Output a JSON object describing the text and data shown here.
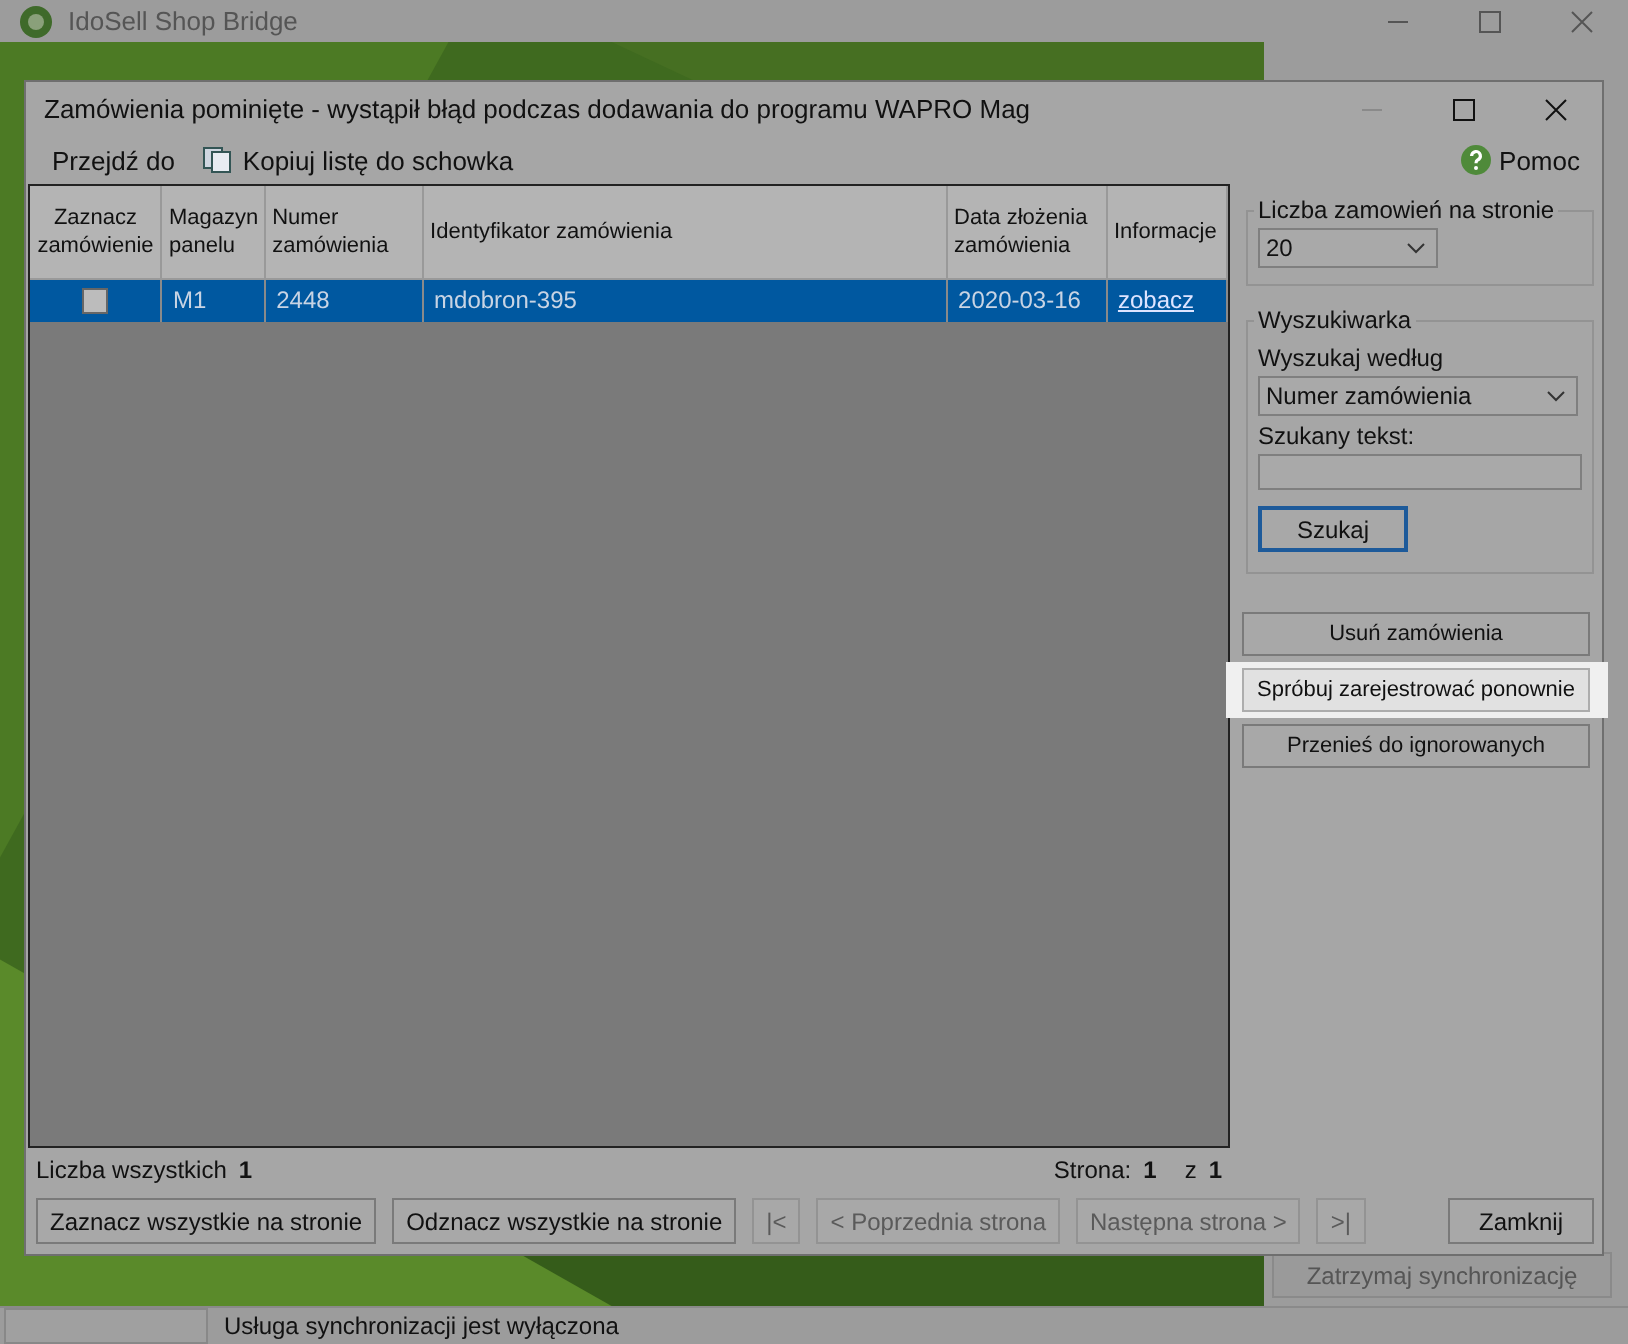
{
  "main_window": {
    "title": "IdoSell Shop Bridge",
    "stop_button": {
      "label": "Zatrzymaj synchronizację",
      "disabled": true
    },
    "sync_progress": {
      "level": 0
    },
    "status_bar": "Usługa synchronizacji jest wyłączona"
  },
  "dialog": {
    "title": "Zamówienia pominięte - wystąpił błąd podczas dodawania do programu WAPRO Mag",
    "toolbar": [
      {
        "label": "Przejdź do",
        "kind": "menu"
      },
      {
        "label": "Kopiuj listę do schowka",
        "kind": "copy"
      }
    ],
    "help": "Pomoc",
    "table": {
      "columns": [
        "Zaznacz zamówienie",
        "Magazyn panelu",
        "Numer zamówienia",
        "Identyfikator zamówienia",
        "Data złożenia zamówienia",
        "Informacje"
      ],
      "rows": [
        {
          "checked": false,
          "selected": true,
          "warehouse": "M1",
          "number": "2448",
          "identifier": "mdobron-395",
          "date": "2020-03-16",
          "link": "zobacz"
        }
      ]
    },
    "panel": {
      "per_page_label": "Liczba zamowień na stronie",
      "per_page": "20",
      "search_group": "Wyszukiwarka",
      "search_by_label": "Wyszukaj według",
      "search_by": "Numer zamówienia",
      "search_text_label": "Szukany tekst:",
      "search_button": "Szukaj",
      "actions": [
        {
          "label": "Usuń zamówienia",
          "highlighted": false
        },
        {
          "label": "Spróbuj zarejestrować ponownie",
          "highlighted": true
        },
        {
          "label": "Przenieś do ignorowanych",
          "highlighted": false
        }
      ]
    },
    "footer": {
      "total_label": "Liczba wszystkich",
      "total": "1",
      "page_label": "Strona:",
      "page": "1",
      "page_sep": "z",
      "pages": "1",
      "buttons": [
        {
          "label": "Zaznacz wszystkie na stronie",
          "disabled": false
        },
        {
          "label": "Odznacz wszystkie na stronie",
          "disabled": false
        },
        {
          "label": "|<",
          "disabled": true
        },
        {
          "label": "< Poprzednia strona",
          "disabled": true
        },
        {
          "label": "Następna strona >",
          "disabled": true
        },
        {
          "label": ">|",
          "disabled": true
        }
      ],
      "close": "Zamknij"
    }
  }
}
